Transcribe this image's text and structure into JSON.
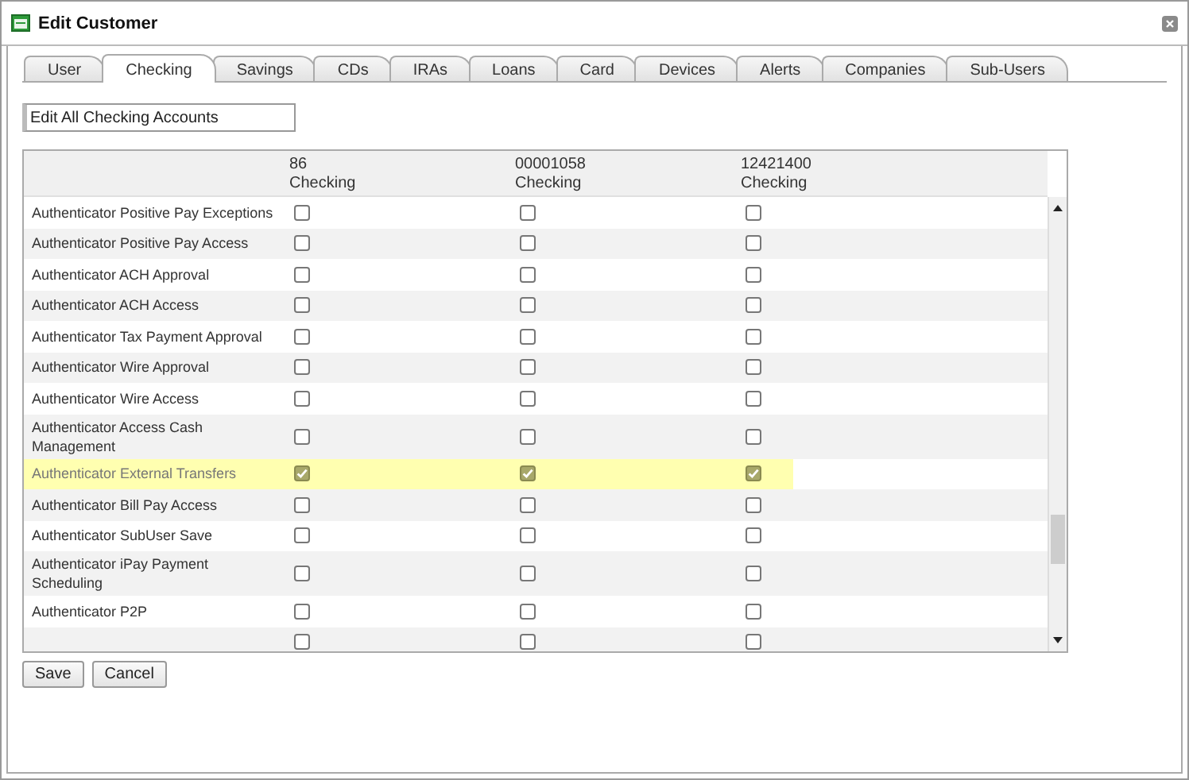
{
  "window": {
    "title": "Edit Customer"
  },
  "tabs": [
    {
      "label": "User",
      "selected": false
    },
    {
      "label": "Checking",
      "selected": true
    },
    {
      "label": "Savings",
      "selected": false
    },
    {
      "label": "CDs",
      "selected": false
    },
    {
      "label": "IRAs",
      "selected": false
    },
    {
      "label": "Loans",
      "selected": false
    },
    {
      "label": "Card",
      "selected": false
    },
    {
      "label": "Devices",
      "selected": false
    },
    {
      "label": "Alerts",
      "selected": false
    },
    {
      "label": "Companies",
      "selected": false
    },
    {
      "label": "Sub-Users",
      "selected": false
    }
  ],
  "edit_all_field": {
    "value": "Edit All Checking Accounts"
  },
  "table": {
    "columns": [
      {
        "number": "86",
        "type": "Checking"
      },
      {
        "number": "00001058",
        "type": "Checking"
      },
      {
        "number": "12421400",
        "type": "Checking"
      }
    ],
    "rows": [
      {
        "label": "Authenticator Positive Pay Exceptions",
        "selected": false,
        "checks": [
          false,
          false,
          false
        ]
      },
      {
        "label": "Authenticator Positive Pay Access",
        "selected": false,
        "checks": [
          false,
          false,
          false
        ]
      },
      {
        "label": "Authenticator ACH Approval",
        "selected": false,
        "checks": [
          false,
          false,
          false
        ]
      },
      {
        "label": "Authenticator ACH Access",
        "selected": false,
        "checks": [
          false,
          false,
          false
        ]
      },
      {
        "label": "Authenticator Tax Payment Approval",
        "selected": false,
        "checks": [
          false,
          false,
          false
        ]
      },
      {
        "label": "Authenticator Wire Approval",
        "selected": false,
        "checks": [
          false,
          false,
          false
        ]
      },
      {
        "label": "Authenticator Wire Access",
        "selected": false,
        "checks": [
          false,
          false,
          false
        ]
      },
      {
        "label": "Authenticator Access Cash\nManagement",
        "selected": false,
        "checks": [
          false,
          false,
          false
        ]
      },
      {
        "label": "Authenticator External Transfers",
        "selected": true,
        "checks": [
          true,
          true,
          true
        ]
      },
      {
        "label": "Authenticator Bill Pay Access",
        "selected": false,
        "checks": [
          false,
          false,
          false
        ]
      },
      {
        "label": "Authenticator SubUser Save",
        "selected": false,
        "checks": [
          false,
          false,
          false
        ]
      },
      {
        "label": "Authenticator iPay Payment\nScheduling",
        "selected": false,
        "checks": [
          false,
          false,
          false
        ]
      },
      {
        "label": "Authenticator P2P",
        "selected": false,
        "checks": [
          false,
          false,
          false
        ]
      },
      {
        "selected": false,
        "checks": [
          false,
          false,
          false
        ]
      }
    ]
  },
  "buttons": [
    "Save",
    "Cancel"
  ]
}
